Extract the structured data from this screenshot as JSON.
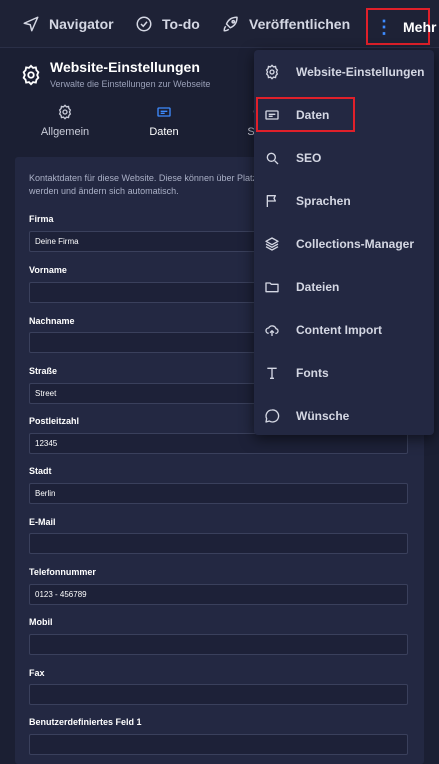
{
  "topnav": {
    "navigator": "Navigator",
    "todo": "To-do",
    "publish": "Veröffentlichen",
    "more": "Mehr"
  },
  "panel": {
    "title": "Website-Einstellungen",
    "subtitle": "Verwalte die Einstellungen zur Webseite",
    "tabs": [
      {
        "label": "Allgemein",
        "icon": "gear-icon"
      },
      {
        "label": "Daten",
        "icon": "card-icon",
        "active": true
      },
      {
        "label": "SEO",
        "icon": "search-icon"
      }
    ]
  },
  "form": {
    "intro": "Kontaktdaten für diese Website. Diese können über Platzhalter auf der Seite verwendet werden und ändern sich automatisch.",
    "fields": [
      {
        "label": "Firma",
        "value": "Deine Firma"
      },
      {
        "label": "Vorname",
        "value": ""
      },
      {
        "label": "Nachname",
        "value": ""
      },
      {
        "label": "Straße",
        "value": "Street"
      },
      {
        "label": "Postleitzahl",
        "value": "12345"
      },
      {
        "label": "Stadt",
        "value": "Berlin"
      },
      {
        "label": "E-Mail",
        "value": ""
      },
      {
        "label": "Telefonnummer",
        "value": "0123 - 456789"
      },
      {
        "label": "Mobil",
        "value": ""
      },
      {
        "label": "Fax",
        "value": ""
      },
      {
        "label": "Benutzerdefiniertes Feld 1",
        "value": ""
      }
    ]
  },
  "menu": {
    "items": [
      {
        "label": "Website-Einstellungen",
        "icon": "gear-icon"
      },
      {
        "label": "Daten",
        "icon": "card-icon",
        "highlighted": true
      },
      {
        "label": "SEO",
        "icon": "search-icon"
      },
      {
        "label": "Sprachen",
        "icon": "flag-icon"
      },
      {
        "label": "Collections-Manager",
        "icon": "layers-icon"
      },
      {
        "label": "Dateien",
        "icon": "folder-icon"
      },
      {
        "label": "Content Import",
        "icon": "cloud-upload-icon"
      },
      {
        "label": "Fonts",
        "icon": "type-icon"
      },
      {
        "label": "Wünsche",
        "icon": "chat-icon"
      }
    ]
  },
  "colors": {
    "accent": "#3d8bff",
    "highlight": "#e0202a",
    "background": "#1b1f33"
  }
}
